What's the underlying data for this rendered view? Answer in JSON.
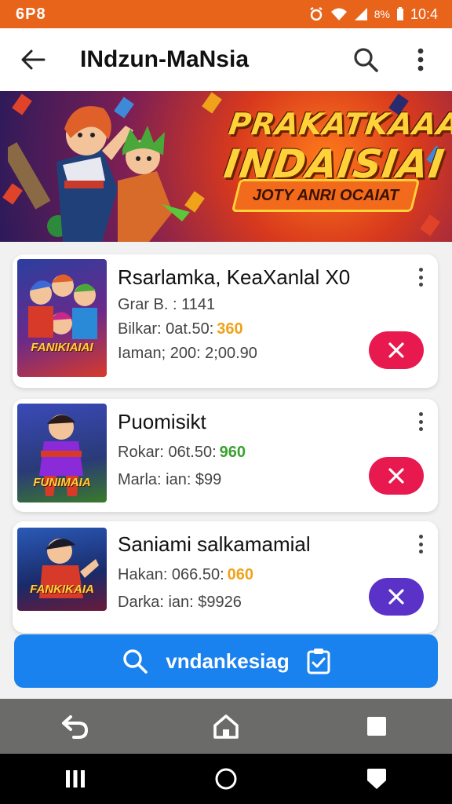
{
  "status_bar": {
    "left_text": "6P8",
    "battery": "8%",
    "time": "10:4"
  },
  "app_bar": {
    "title": "INdzun-MaNsia"
  },
  "banner": {
    "title_line1": "PRAKATKAAA",
    "title_line2": "INDAISIAI",
    "subtitle": "JOTY ANRI OCAIAT"
  },
  "games": [
    {
      "title": "Rsarlamka, KeaXanlal X0",
      "line1": "Grar B. : 1141",
      "line2": "Bilkar: 0at.50:",
      "line2_accent": "360",
      "line2_accent_color": "#f0a21a",
      "line3": "Iaman; 200: 2;00.90",
      "action_color": "#e8194e",
      "thumb_label": "FANIKIAIAI"
    },
    {
      "title": "Puomisikt",
      "line1": "Rokar: 06t.50:",
      "line1_accent": "960",
      "line1_accent_color": "#3aa22e",
      "line2": "Marla: ian: $99",
      "action_color": "#e8194e",
      "thumb_label": "FUNIMAIA"
    },
    {
      "title": "Saniami salkamamial",
      "line1": "Hakan: 066.50:",
      "line1_accent": "060",
      "line1_accent_color": "#f0a21a",
      "line2": "Darka: ian: $9926",
      "action_color": "#5a32c8",
      "thumb_label": "FANKIKAIA"
    }
  ],
  "search_cta": {
    "label": "vndankesiag"
  },
  "colors": {
    "status_bar": "#e8641b",
    "accent_blue": "#1a82ee",
    "nav_gray": "#6b6b69"
  }
}
